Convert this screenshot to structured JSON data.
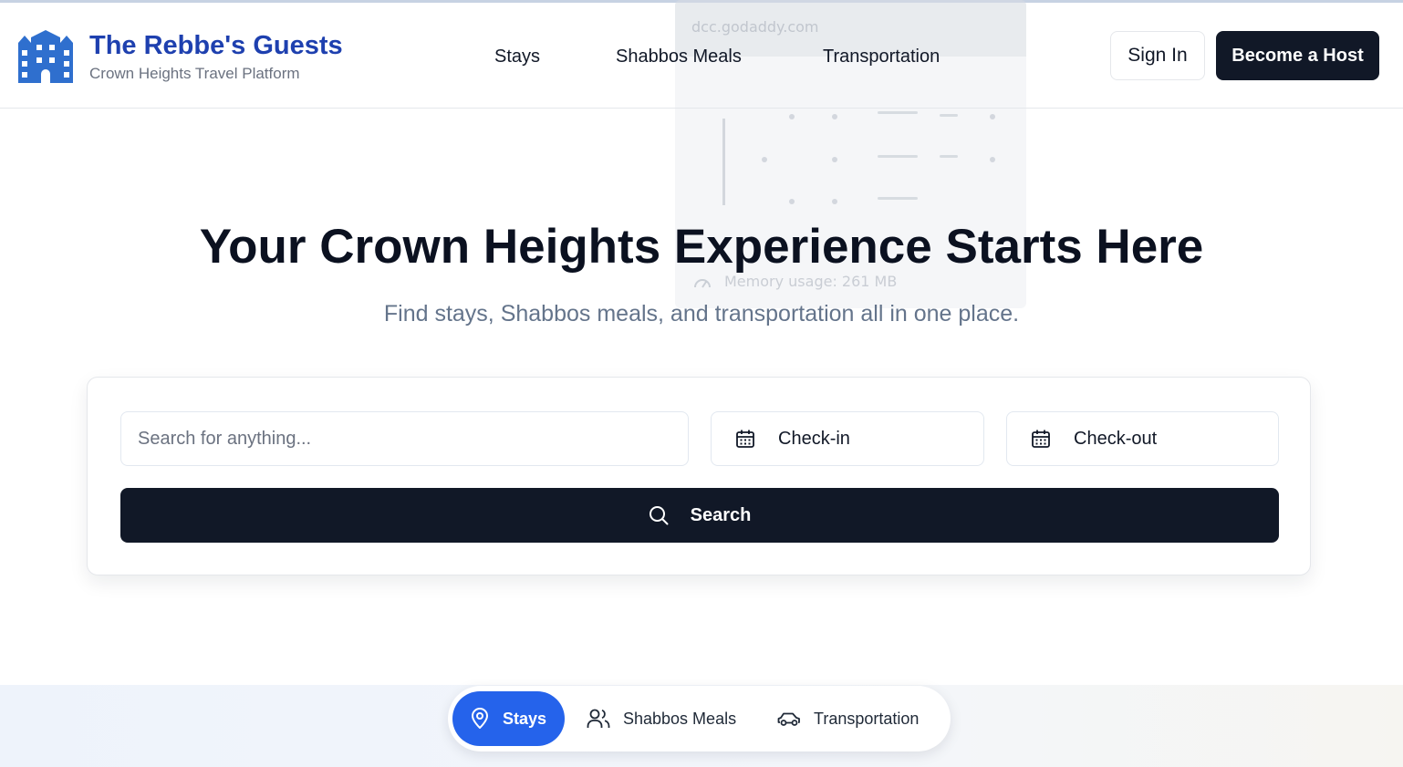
{
  "ghost": {
    "domain": "dcc.godaddy.com",
    "memory": "Memory usage: 261 MB"
  },
  "brand": {
    "title": "The Rebbe's Guests",
    "subtitle": "Crown Heights Travel Platform",
    "logo_icon": "building-icon",
    "color": "#1e40af"
  },
  "nav": {
    "items": [
      {
        "label": "Stays"
      },
      {
        "label": "Shabbos Meals"
      },
      {
        "label": "Transportation"
      }
    ]
  },
  "header_actions": {
    "sign_in": "Sign In",
    "become_host": "Become a Host"
  },
  "hero": {
    "title": "Your Crown Heights Experience Starts Here",
    "subtitle": "Find stays, Shabbos meals, and transportation all in one place."
  },
  "search": {
    "placeholder": "Search for anything...",
    "value": "",
    "check_in": "Check-in",
    "check_out": "Check-out",
    "button": "Search",
    "date_icon": "calendar-icon",
    "button_icon": "search-icon"
  },
  "tabs": {
    "items": [
      {
        "label": "Stays",
        "icon": "map-pin-icon",
        "active": true
      },
      {
        "label": "Shabbos Meals",
        "icon": "users-icon",
        "active": false
      },
      {
        "label": "Transportation",
        "icon": "car-icon",
        "active": false
      }
    ]
  },
  "colors": {
    "primary_dark": "#111827",
    "accent_blue": "#2563eb",
    "muted_text": "#64748b"
  }
}
